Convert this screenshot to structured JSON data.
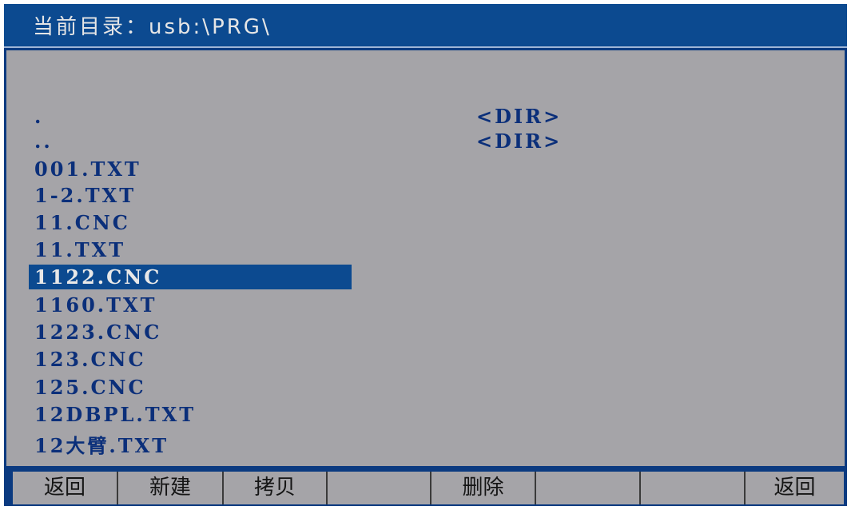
{
  "title": {
    "label": "当前目录：",
    "path": "usb:\\PRG\\"
  },
  "files": [
    {
      "name": ".",
      "type": "<DIR>",
      "selected": false
    },
    {
      "name": "..",
      "type": "<DIR>",
      "selected": false
    },
    {
      "name": "001.TXT",
      "type": "",
      "selected": false
    },
    {
      "name": "1-2.TXT",
      "type": "",
      "selected": false
    },
    {
      "name": "11.CNC",
      "type": "",
      "selected": false
    },
    {
      "name": "11.TXT",
      "type": "",
      "selected": false
    },
    {
      "name": "1122.CNC",
      "type": "",
      "selected": true
    },
    {
      "name": "1160.TXT",
      "type": "",
      "selected": false
    },
    {
      "name": "1223.CNC",
      "type": "",
      "selected": false
    },
    {
      "name": "123.CNC",
      "type": "",
      "selected": false
    },
    {
      "name": "125.CNC",
      "type": "",
      "selected": false
    },
    {
      "name": "12DBPL.TXT",
      "type": "",
      "selected": false
    },
    {
      "name": "12大臂.TXT",
      "type": "",
      "selected": false
    }
  ],
  "softkeys": [
    "返回",
    "新建",
    "拷贝",
    "",
    "删除",
    "",
    "",
    "返回"
  ],
  "colors": {
    "frame_blue": "#0b3a80",
    "title_blue": "#0c4a90",
    "panel_gray": "#a5a4a8",
    "file_text": "#0b2f7a",
    "selection": "#0c4a90"
  }
}
